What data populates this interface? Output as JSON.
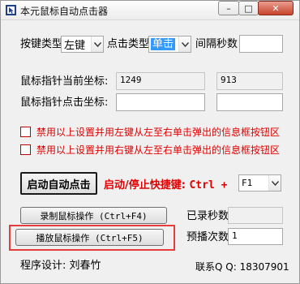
{
  "window": {
    "title": "本元鼠标自动点击器",
    "controls": {
      "minimize": "–",
      "maximize": "□",
      "close": "✕"
    }
  },
  "row1": {
    "button_type_label": "按键类型",
    "button_type_value": "左键",
    "click_type_label": "点击类型",
    "click_type_value": "单击",
    "interval_label": "间隔秒数",
    "interval_value": ""
  },
  "coords": {
    "current_label": "鼠标指针当前坐标:",
    "current_x": "1249",
    "current_y": "913",
    "click_label": "鼠标指针点击坐标:",
    "click_x": "",
    "click_y": ""
  },
  "options": [
    {
      "label": "禁用以上设置并用左键从左至右单击弹出的信息框按钮区",
      "checked": false
    },
    {
      "label": "禁用以上设置并用右键从左至右单击弹出的信息框按钮区",
      "checked": false
    }
  ],
  "actions": {
    "start_button": "启动自动点击",
    "hotkey_label": "启动/停止快捷键:",
    "hotkey_combo": "Ctrl  +",
    "hotkey_key": "F1",
    "record_button": "录制鼠标操作 (Ctrl+F4)",
    "play_button": "播放鼠标操作 (Ctrl+F5)",
    "recorded_seconds_label": "已录秒数",
    "recorded_seconds_value": "",
    "play_count_label": "预播次数",
    "play_count_value": "1"
  },
  "footer": {
    "designer": "程序设计: 刘春竹",
    "contact": "联系Q Q: 18307901"
  },
  "colors": {
    "accent_red": "#e00000",
    "highlight_red": "#e53d3d",
    "selection_blue": "#3399ff"
  }
}
